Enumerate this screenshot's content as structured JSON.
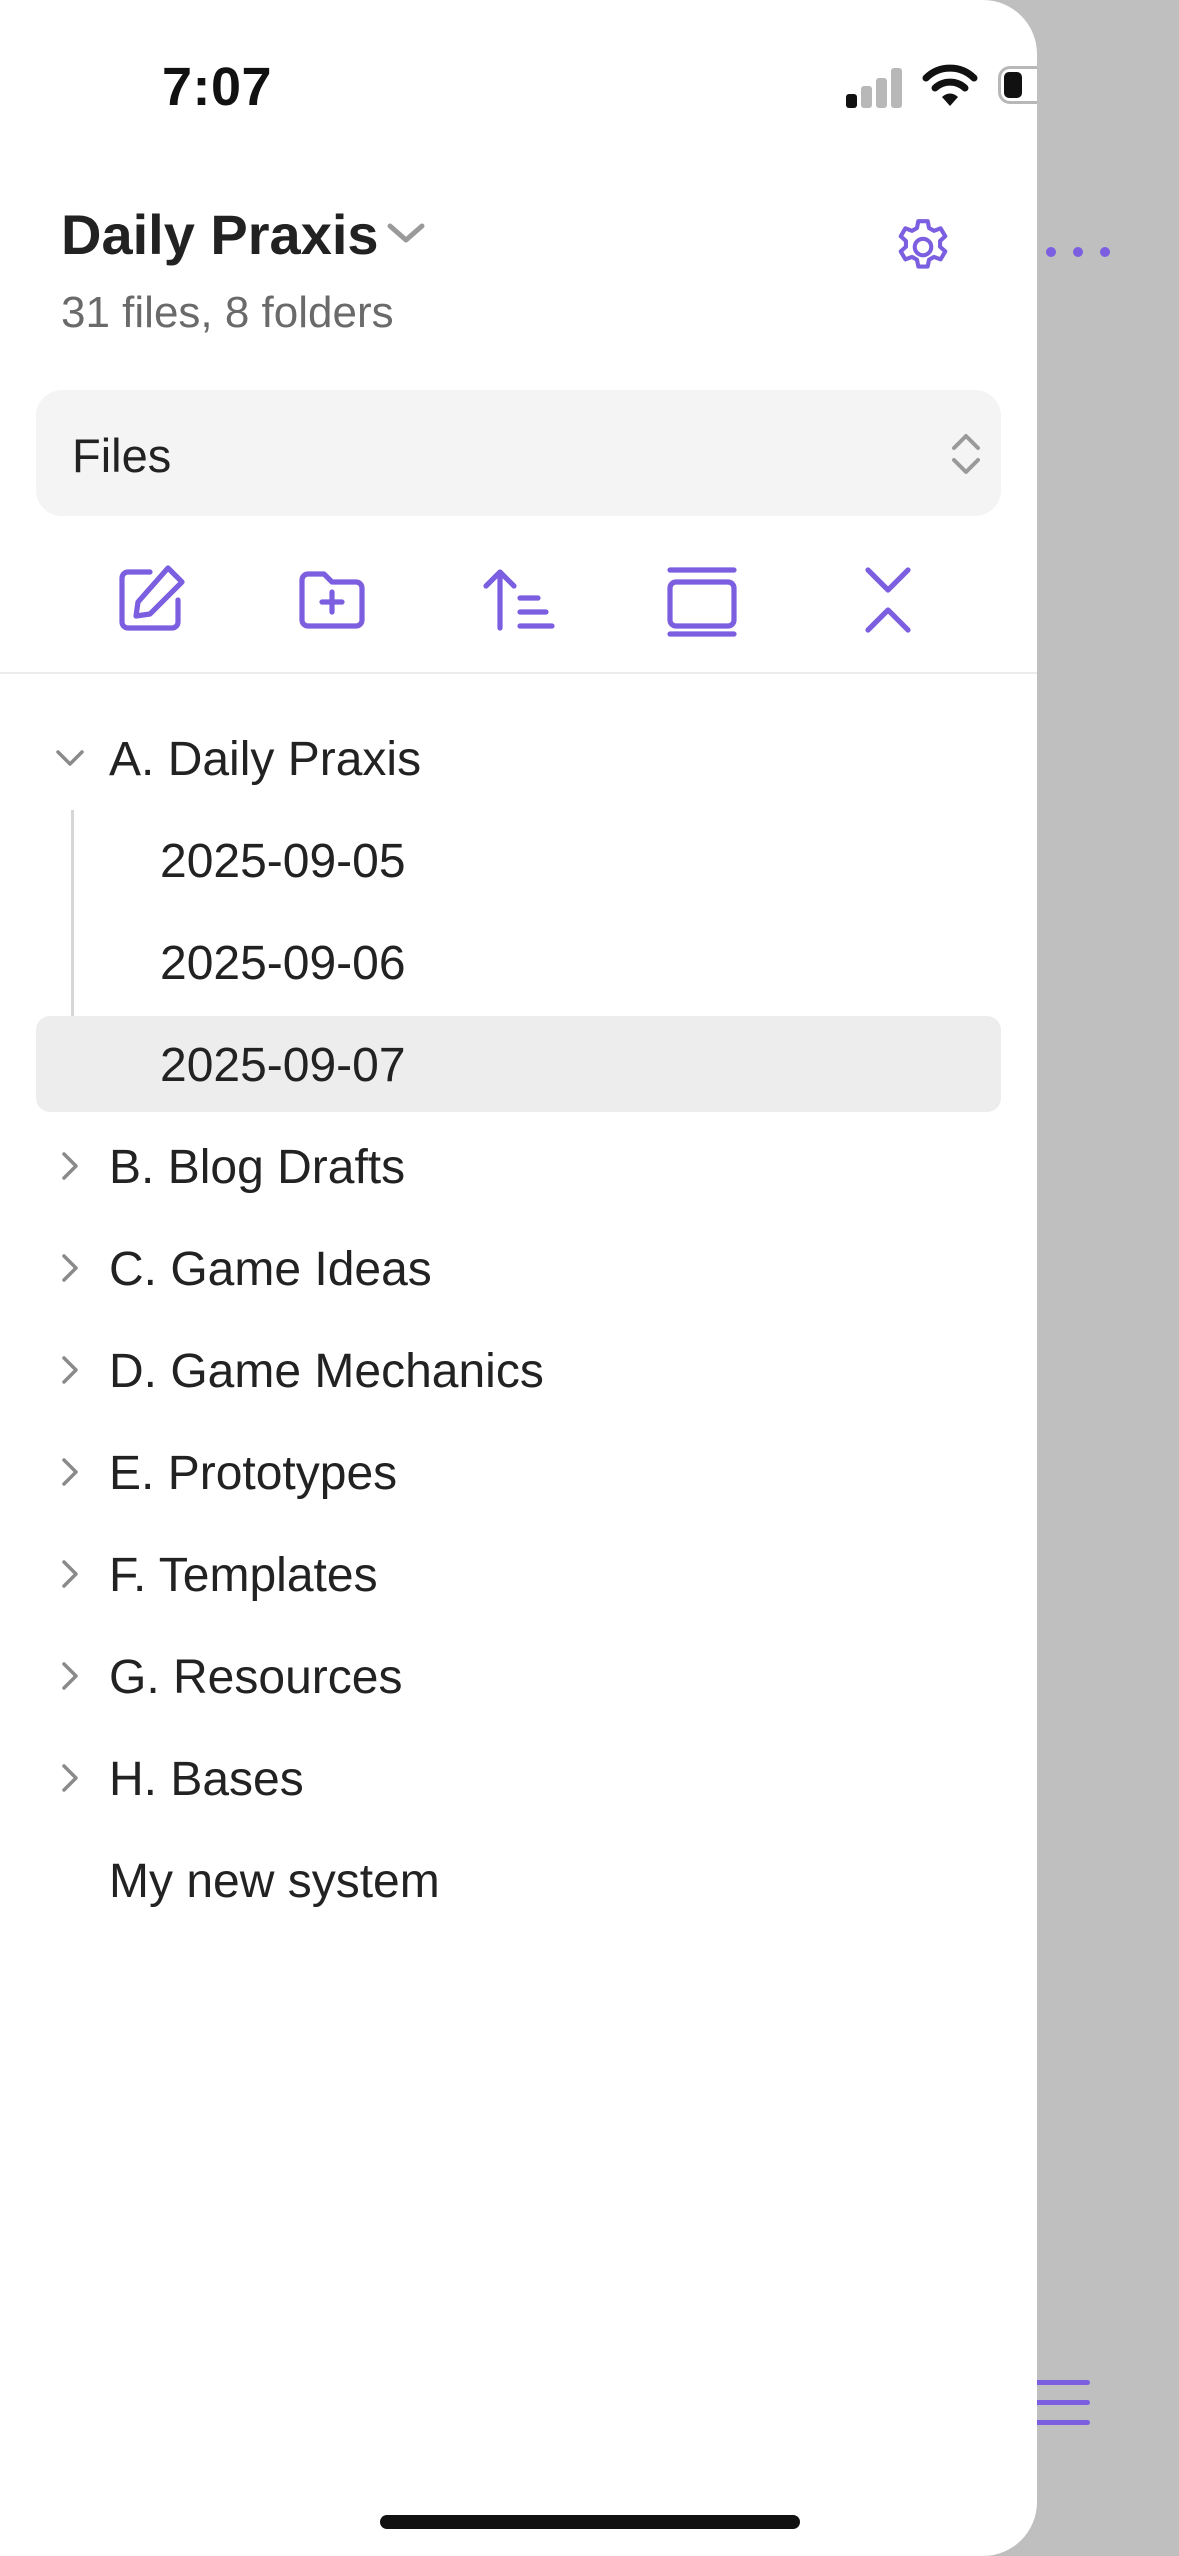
{
  "status_bar": {
    "time": "7:07"
  },
  "header": {
    "vault_name": "Daily Praxis",
    "vault_stats": "31 files, 8 folders"
  },
  "view_selector": {
    "label": "Files"
  },
  "toolbar": {
    "icons": [
      "new-note-icon",
      "new-folder-icon",
      "sort-icon",
      "reveal-icon",
      "collapse-all-icon"
    ]
  },
  "tree": {
    "items": [
      {
        "label": "A. Daily Praxis",
        "type": "folder",
        "expanded": true
      },
      {
        "label": "2025-09-05",
        "type": "file"
      },
      {
        "label": "2025-09-06",
        "type": "file"
      },
      {
        "label": "2025-09-07",
        "type": "file",
        "active": true
      },
      {
        "label": "B. Blog Drafts",
        "type": "folder",
        "expanded": false
      },
      {
        "label": "C. Game Ideas",
        "type": "folder",
        "expanded": false
      },
      {
        "label": "D. Game Mechanics",
        "type": "folder",
        "expanded": false
      },
      {
        "label": "E. Prototypes",
        "type": "folder",
        "expanded": false
      },
      {
        "label": "F. Templates",
        "type": "folder",
        "expanded": false
      },
      {
        "label": "G. Resources",
        "type": "folder",
        "expanded": false
      },
      {
        "label": "H. Bases",
        "type": "folder",
        "expanded": false
      },
      {
        "label": "My new system",
        "type": "file"
      }
    ]
  },
  "colors": {
    "accent": "#7b5fe0",
    "active_row": "#ededed",
    "drawer_bg": "#ffffff",
    "backdrop": "#bfbfbf"
  }
}
